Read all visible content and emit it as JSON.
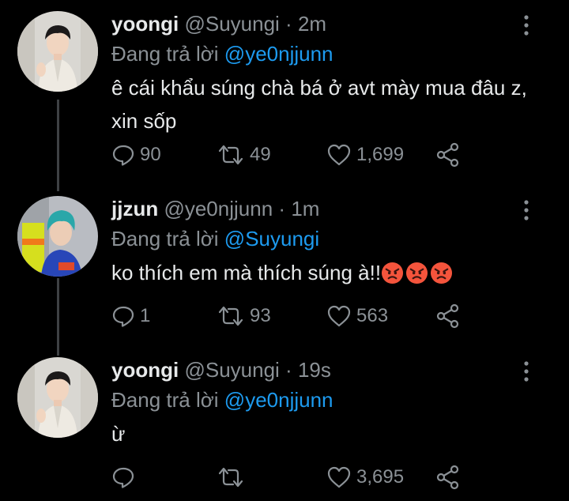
{
  "tweets": [
    {
      "name": "yoongi",
      "handle": "@Suyungi",
      "time": "2m",
      "reply_prefix": "Đang trả lời",
      "reply_to": "@ye0njjunn",
      "text": "ê cái khẩu súng chà bá ở avt mày mua đâu z, xin sốp",
      "replies": "90",
      "retweets": "49",
      "likes": "1,699"
    },
    {
      "name": "jjzun",
      "handle": "@ye0njjunn",
      "time": "1m",
      "reply_prefix": "Đang trả lời",
      "reply_to": "@Suyungi",
      "text": "ko thích em mà thích súng à!!",
      "emojis": [
        "angry-face",
        "angry-face",
        "angry-face"
      ],
      "replies": "1",
      "retweets": "93",
      "likes": "563"
    },
    {
      "name": "yoongi",
      "handle": "@Suyungi",
      "time": "19s",
      "reply_prefix": "Đang trả lời",
      "reply_to": "@ye0njjunn",
      "text": "ừ",
      "replies": "",
      "retweets": "",
      "likes": "3,695"
    }
  ],
  "separator": "·",
  "colors": {
    "background": "#000000",
    "text": "#e7e9ea",
    "secondary": "#8b9196",
    "mention": "#1d9bf0",
    "thread_line": "#3e4144"
  },
  "icons": [
    "reply-icon",
    "retweet-icon",
    "like-icon",
    "share-icon",
    "more-icon"
  ]
}
